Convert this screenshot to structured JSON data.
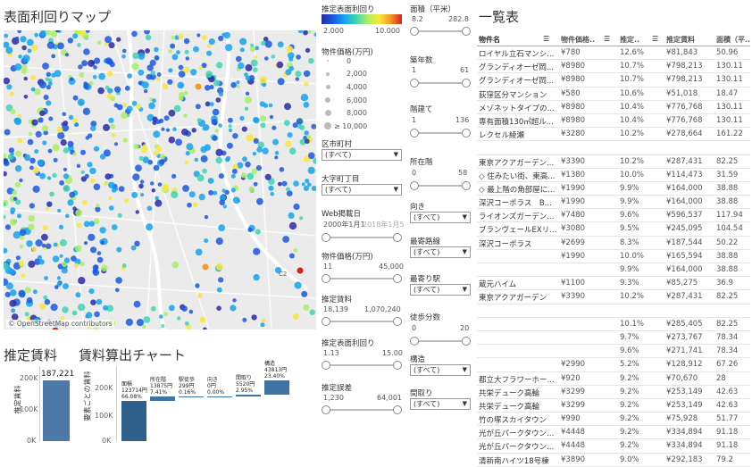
{
  "map": {
    "title": "表面利回りマップ",
    "attribution": "© OpenStreetMap contributors",
    "highway_label": "C2"
  },
  "legend": {
    "yield_title": "推定表面利回り",
    "yield_min": "2.000",
    "yield_max": "10.000",
    "price_title": "物件価格(万円)",
    "price_items": [
      "0",
      "2,000",
      "4,000",
      "6,000",
      "8,000",
      "≥ 10,000"
    ]
  },
  "filters_left": {
    "ward": {
      "label": "区市町村",
      "value": "(すべて)"
    },
    "chome": {
      "label": "大字町丁目",
      "value": "(すべて)"
    },
    "web_date": {
      "label": "Web掲載日",
      "min": "2000年1月1",
      "max": "2018年1月5"
    },
    "price": {
      "label": "物件価格(万円)",
      "min": "11",
      "max": "45,000"
    },
    "rent": {
      "label": "推定賃料",
      "min": "18,139",
      "max": "1,070,240"
    },
    "yield": {
      "label": "推定表面利回り",
      "min": "1.13",
      "max": "15.00"
    },
    "error": {
      "label": "推定誤差",
      "min": "1,230",
      "max": "64,001"
    }
  },
  "filters_right": {
    "area": {
      "label": "面積（平米）",
      "min": "8.2",
      "max": "282.8"
    },
    "age": {
      "label": "築年数",
      "min": "1",
      "max": "61"
    },
    "floors": {
      "label": "階建て",
      "min": "1",
      "max": "136"
    },
    "floor": {
      "label": "所在階",
      "min": "0",
      "max": "58"
    },
    "direction": {
      "label": "向き",
      "value": "(すべて)"
    },
    "line": {
      "label": "最寄路線",
      "value": "(すべて)"
    },
    "station": {
      "label": "最寄り駅",
      "value": "(すべて)"
    },
    "walk": {
      "label": "徒歩分数",
      "min": "0",
      "max": "20"
    },
    "structure": {
      "label": "構造",
      "value": "(すべて)"
    },
    "layout": {
      "label": "間取り",
      "value": "(すべて)"
    }
  },
  "table": {
    "title": "一覧表",
    "headers": [
      "物件名",
      "物件価格..",
      "推定..",
      "推定賃料",
      "面積（平..."
    ],
    "rows": [
      [
        "ロイヤル立石マンシ...",
        "¥780",
        "12.6%",
        "¥81,843",
        "50.96"
      ],
      [
        "グランディオーゼ岡...",
        "¥8980",
        "10.7%",
        "¥798,213",
        "130.11"
      ],
      [
        "グランディオーゼ岡...",
        "¥8980",
        "10.7%",
        "¥798,213",
        "130.11"
      ],
      [
        "荻窪区分マンション",
        "¥580",
        "10.6%",
        "¥51,018",
        "18.47"
      ],
      [
        "メゾネットタイプの...",
        "¥8980",
        "10.4%",
        "¥776,768",
        "130.11"
      ],
      [
        "専有面積130㎡超ル...",
        "¥8980",
        "10.4%",
        "¥776,768",
        "130.11"
      ],
      [
        "レクセル綾瀬",
        "¥3280",
        "10.2%",
        "¥278,664",
        "161.22"
      ],
      [
        "",
        "",
        "",
        "",
        ""
      ],
      [
        "東京アクアガーデン...",
        "¥3390",
        "10.2%",
        "¥287,431",
        "82.25"
      ],
      [
        "◇ 住みたい街、東高...",
        "¥1380",
        "10.0%",
        "¥114,473",
        "31.59"
      ],
      [
        "◇ 最上階の角部屋に...",
        "¥1990",
        "9.9%",
        "¥164,000",
        "38.88"
      ],
      [
        "深沢コーポラス　B...",
        "¥1990",
        "9.9%",
        "¥164,000",
        "38.88"
      ],
      [
        "ライオンズガーデン...",
        "¥7480",
        "9.6%",
        "¥596,537",
        "117.94"
      ],
      [
        "ブランヴェールEXリ...",
        "¥3080",
        "9.5%",
        "¥245,095",
        "104.54"
      ],
      [
        "深沢コーポラス",
        "¥2699",
        "8.3%",
        "¥187,544",
        "50.22"
      ],
      [
        "",
        "¥1990",
        "10.0%",
        "¥165,594",
        "38.88"
      ],
      [
        "",
        "",
        "9.9%",
        "¥164,000",
        "38.88"
      ],
      [
        "蔵元ハイム",
        "¥1100",
        "9.3%",
        "¥85,275",
        "36.9"
      ],
      [
        "東京アクアガーデン",
        "¥3390",
        "10.2%",
        "¥287,431",
        "82.25"
      ],
      [
        "",
        "",
        "",
        "",
        ""
      ],
      [
        "",
        "",
        "10.1%",
        "¥285,405",
        "82.25"
      ],
      [
        "",
        "",
        "9.7%",
        "¥273,767",
        "78.34"
      ],
      [
        "",
        "",
        "9.6%",
        "¥271,741",
        "78.34"
      ],
      [
        "",
        "¥2990",
        "5.2%",
        "¥128,912",
        "67.26"
      ],
      [
        "都立大フラワーホー...",
        "¥920",
        "9.2%",
        "¥70,670",
        "28"
      ],
      [
        "共栄デューク高輪",
        "¥3299",
        "9.2%",
        "¥253,149",
        "42.63"
      ],
      [
        "共栄デューク高輪",
        "¥3299",
        "9.2%",
        "¥253,149",
        "42.63"
      ],
      [
        "竹の塚スカイタウン",
        "¥990",
        "9.2%",
        "¥75,928",
        "51.77"
      ],
      [
        "光が丘パークタウン...",
        "¥4448",
        "9.2%",
        "¥334,894",
        "91.18"
      ],
      [
        "光が丘パークタウン...",
        "¥4448",
        "9.2%",
        "¥334,894",
        "91.18"
      ],
      [
        "清新南ハイツ18号棟",
        "¥3890",
        "9.0%",
        "¥292,183",
        "79.2"
      ]
    ]
  },
  "rent_chart": {
    "title": "推定賃料",
    "ylabel": "推定賃料",
    "ticks": [
      "200K",
      "100K",
      "0K"
    ],
    "value_label": "187,221"
  },
  "calc_chart": {
    "title": "賃料算出チャート",
    "ylabel": "要素ごとの賃料",
    "ticks": [
      "200K",
      "100K",
      "0K"
    ],
    "items": [
      {
        "name": "面積",
        "value": "123714円",
        "pct": "66.08%"
      },
      {
        "name": "所在階",
        "value": "13875円",
        "pct": "7.41%"
      },
      {
        "name": "駅徒歩",
        "value": "299円",
        "pct": "0.16%"
      },
      {
        "name": "向き",
        "value": "0円",
        "pct": "0.00%"
      },
      {
        "name": "間取り",
        "value": "5520円",
        "pct": "2.95%"
      },
      {
        "name": "構造",
        "value": "43813円",
        "pct": "23.40%"
      }
    ]
  },
  "chart_data": [
    {
      "type": "bar",
      "title": "推定賃料",
      "ylabel": "推定賃料",
      "categories": [
        ""
      ],
      "values": [
        187221
      ],
      "ylim": [
        0,
        230000
      ]
    },
    {
      "type": "bar",
      "title": "賃料算出チャート",
      "ylabel": "要素ごとの賃料",
      "categories": [
        "面積",
        "所在階",
        "駅徒歩",
        "向き",
        "間取り",
        "構造"
      ],
      "values": [
        123714,
        13875,
        299,
        0,
        5520,
        43813
      ],
      "ylim": [
        0,
        230000
      ]
    }
  ]
}
